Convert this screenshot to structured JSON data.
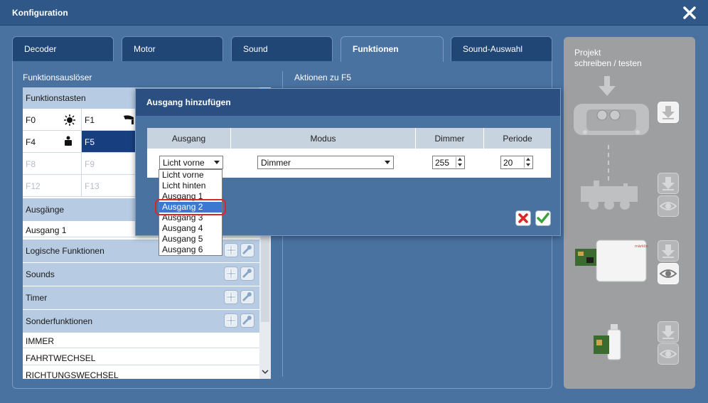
{
  "window": {
    "title": "Konfiguration",
    "close_icon": "close-icon"
  },
  "tabs": [
    {
      "label": "Decoder",
      "active": false
    },
    {
      "label": "Motor",
      "active": false
    },
    {
      "label": "Sound",
      "active": false
    },
    {
      "label": "Funktionen",
      "active": true
    },
    {
      "label": "Sound-Auswahl",
      "active": false
    }
  ],
  "left": {
    "section_title": "Funktionsauslöser",
    "funktionstasten_header": "Funktionstasten",
    "keys": [
      {
        "label": "F0",
        "icon": "light-icon",
        "state": "normal"
      },
      {
        "label": "F1",
        "icon": "horn-icon",
        "state": "normal"
      },
      {
        "label": "F4",
        "icon": "person-icon",
        "state": "normal"
      },
      {
        "label": "F5",
        "icon": "",
        "state": "selected"
      },
      {
        "label": "F8",
        "icon": "",
        "state": "disabled"
      },
      {
        "label": "F9",
        "icon": "",
        "state": "disabled"
      },
      {
        "label": "F12",
        "icon": "",
        "state": "disabled"
      },
      {
        "label": "F13",
        "icon": "",
        "state": "disabled"
      }
    ],
    "ausgaenge_header": "Ausgänge",
    "ausgaenge_items": [
      "Ausgang 1"
    ],
    "logische_header": "Logische Funktionen",
    "sounds_header": "Sounds",
    "timer_header": "Timer",
    "sonder_header": "Sonderfunktionen",
    "sonder_items": [
      "IMMER",
      "FAHRTWECHSEL",
      "RICHTUNGSWECHSEL"
    ]
  },
  "right": {
    "section_title": "Aktionen zu F5"
  },
  "dialog": {
    "title": "Ausgang hinzufügen",
    "columns": [
      "Ausgang",
      "Modus",
      "Dimmer",
      "Periode"
    ],
    "ausgang_value": "Licht vorne",
    "modus_value": "Dimmer",
    "dimmer_value": "255",
    "periode_value": "20",
    "dropdown_options": [
      "Licht vorne",
      "Licht hinten",
      "Ausgang 1",
      "Ausgang 2",
      "Ausgang 3",
      "Ausgang 4",
      "Ausgang 5",
      "Ausgang 6"
    ],
    "highlighted_option": "Ausgang 2",
    "cancel_icon": "cancel-icon",
    "confirm_icon": "check-icon"
  },
  "project_panel": {
    "title_line1": "Projekt",
    "title_line2": "schreiben / testen",
    "devices": [
      "central-station-icon",
      "locomotive-icon",
      "programmer-icon",
      "usb-stick-icon"
    ],
    "button_icons": [
      "download-icon",
      "eye-icon"
    ]
  },
  "colors": {
    "selected_row": "#173f80",
    "highlight_option": "#3c78d0",
    "annotation": "#d9262b",
    "cancel": "#d9262b",
    "confirm": "#3da23d"
  }
}
